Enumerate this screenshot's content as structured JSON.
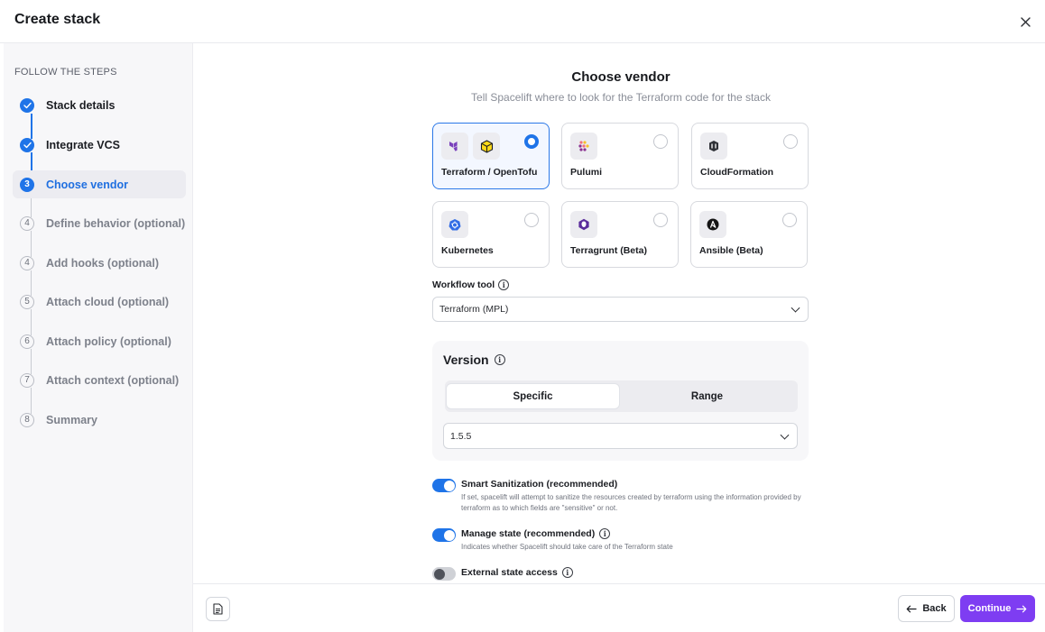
{
  "header": {
    "title": "Create stack"
  },
  "sidebar": {
    "heading": "FOLLOW THE STEPS",
    "steps": [
      {
        "marker": "",
        "label": "Stack details",
        "state": "done"
      },
      {
        "marker": "",
        "label": "Integrate VCS",
        "state": "done"
      },
      {
        "marker": "3",
        "label": "Choose vendor",
        "state": "current"
      },
      {
        "marker": "4",
        "label": "Define behavior (optional)",
        "state": "todo"
      },
      {
        "marker": "4",
        "label": "Add hooks (optional)",
        "state": "todo"
      },
      {
        "marker": "5",
        "label": "Attach cloud (optional)",
        "state": "todo"
      },
      {
        "marker": "6",
        "label": "Attach policy (optional)",
        "state": "todo"
      },
      {
        "marker": "7",
        "label": "Attach context (optional)",
        "state": "todo"
      },
      {
        "marker": "8",
        "label": "Summary",
        "state": "todo"
      }
    ]
  },
  "main": {
    "title": "Choose vendor",
    "subtitle": "Tell Spacelift where to look for the Terraform code for the stack",
    "vendors": [
      {
        "name": "Terraform / OpenTofu",
        "selected": true,
        "icons": [
          "terraform-icon",
          "opentofu-icon"
        ]
      },
      {
        "name": "Pulumi",
        "selected": false,
        "icons": [
          "pulumi-icon"
        ]
      },
      {
        "name": "CloudFormation",
        "selected": false,
        "icons": [
          "cloudformation-icon"
        ]
      },
      {
        "name": "Kubernetes",
        "selected": false,
        "icons": [
          "kubernetes-icon"
        ]
      },
      {
        "name": "Terragrunt (Beta)",
        "selected": false,
        "icons": [
          "terragrunt-icon"
        ]
      },
      {
        "name": "Ansible (Beta)",
        "selected": false,
        "icons": [
          "ansible-icon"
        ]
      }
    ],
    "workflow_tool": {
      "label": "Workflow tool",
      "value": "Terraform (MPL)"
    },
    "version": {
      "title": "Version",
      "tabs": [
        "Specific",
        "Range"
      ],
      "active_tab": "Specific",
      "value": "1.5.5"
    },
    "options": [
      {
        "title": "Smart Sanitization (recommended)",
        "enabled": true,
        "info": false,
        "description": "If set, spacelift will attempt to sanitize the resources created by terraform using the information provided by terraform as to which fields are \"sensitive\" or not."
      },
      {
        "title": "Manage state (recommended)",
        "enabled": true,
        "info": true,
        "description": "Indicates whether Spacelift should take care of the Terraform state"
      },
      {
        "title": "External state access",
        "enabled": false,
        "info": true,
        "description": ""
      }
    ]
  },
  "footer": {
    "back_label": "Back",
    "continue_label": "Continue"
  },
  "colors": {
    "accent_blue": "#1f74e8",
    "primary_purple": "#7e3df2"
  }
}
